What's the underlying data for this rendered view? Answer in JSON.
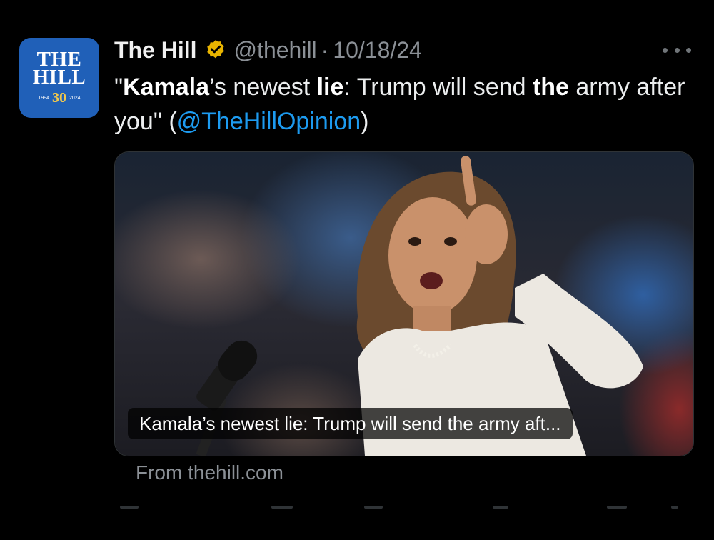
{
  "account": {
    "avatar_text": [
      "THE",
      "HILL"
    ],
    "avatar_year_start": "1994",
    "avatar_anniversary": "30",
    "avatar_year_end": "2024",
    "name": "The Hill",
    "handle": "@thehill",
    "separator": "·",
    "date": "10/18/24",
    "verified_color": "#f2c94c",
    "brand_color": "#2060b8"
  },
  "tweet": {
    "quote_open": "\"",
    "part1_bold": "Kamala",
    "part2": "’s newest ",
    "part3_bold": "lie",
    "part4": ": Trump will send ",
    "part5_bold": "the",
    "part6": " army after you\" (",
    "mention": "@TheHillOpinion",
    "close": ")",
    "mention_color": "#1d9bf0"
  },
  "card": {
    "caption": "Kamala’s newest lie: Trump will send the army aft...",
    "source": "From thehill.com"
  },
  "icons": {
    "verified": "verified-badge-icon",
    "more": "more-options-icon"
  }
}
